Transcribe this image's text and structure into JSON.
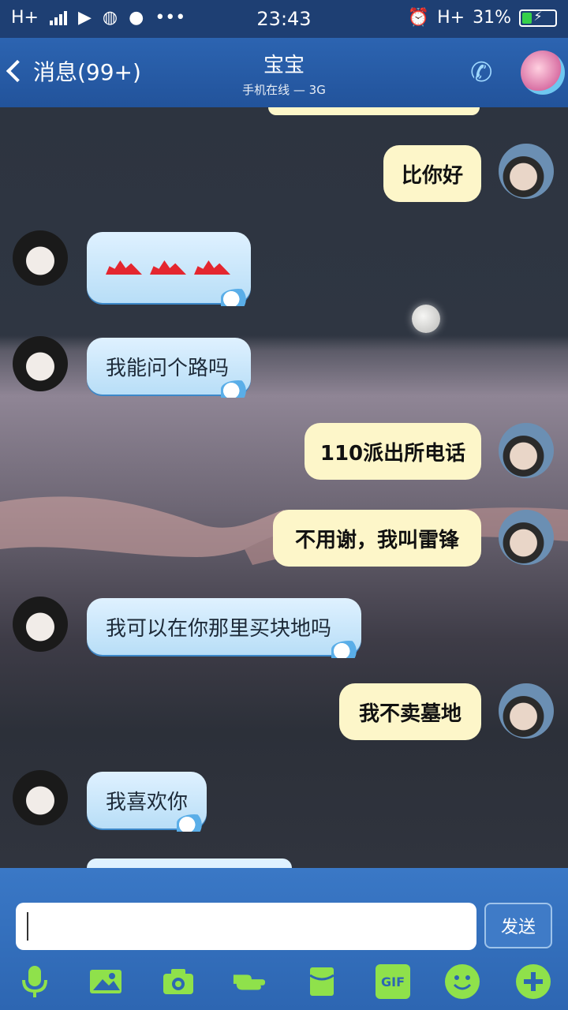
{
  "status_bar": {
    "network_left": "H+",
    "time": "23:43",
    "network_right": "H+",
    "battery_percent": "31%",
    "battery_level": 0.31
  },
  "header": {
    "back_label": "消息(99+)",
    "contact_name": "宝宝",
    "contact_status": "手机在线 — 3G"
  },
  "messages": [
    {
      "side": "out",
      "text": "比你好"
    },
    {
      "side": "in",
      "text": ""
    },
    {
      "side": "in",
      "text": "我能问个路吗"
    },
    {
      "side": "out",
      "text": "110派出所电话"
    },
    {
      "side": "out",
      "text": "不用谢，我叫雷锋"
    },
    {
      "side": "in",
      "text": "我可以在你那里买块地吗"
    },
    {
      "side": "out",
      "text": "我不卖墓地"
    },
    {
      "side": "in",
      "text": "我喜欢你"
    }
  ],
  "composer": {
    "input_value": "",
    "send_label": "发送",
    "gif_label": "GIF"
  },
  "icons": {
    "voice": "microphone-icon",
    "image": "picture-icon",
    "camera": "camera-icon",
    "poke": "poke-hand-icon",
    "red_packet": "red-packet-icon",
    "gif": "gif-icon",
    "emoji": "emoji-icon",
    "more": "plus-icon"
  },
  "colors": {
    "header_blue": "#22539b",
    "incoming_bubble": "#dff1ff",
    "outgoing_bubble": "#fdf6c9",
    "tool_green": "#8fe14b"
  }
}
